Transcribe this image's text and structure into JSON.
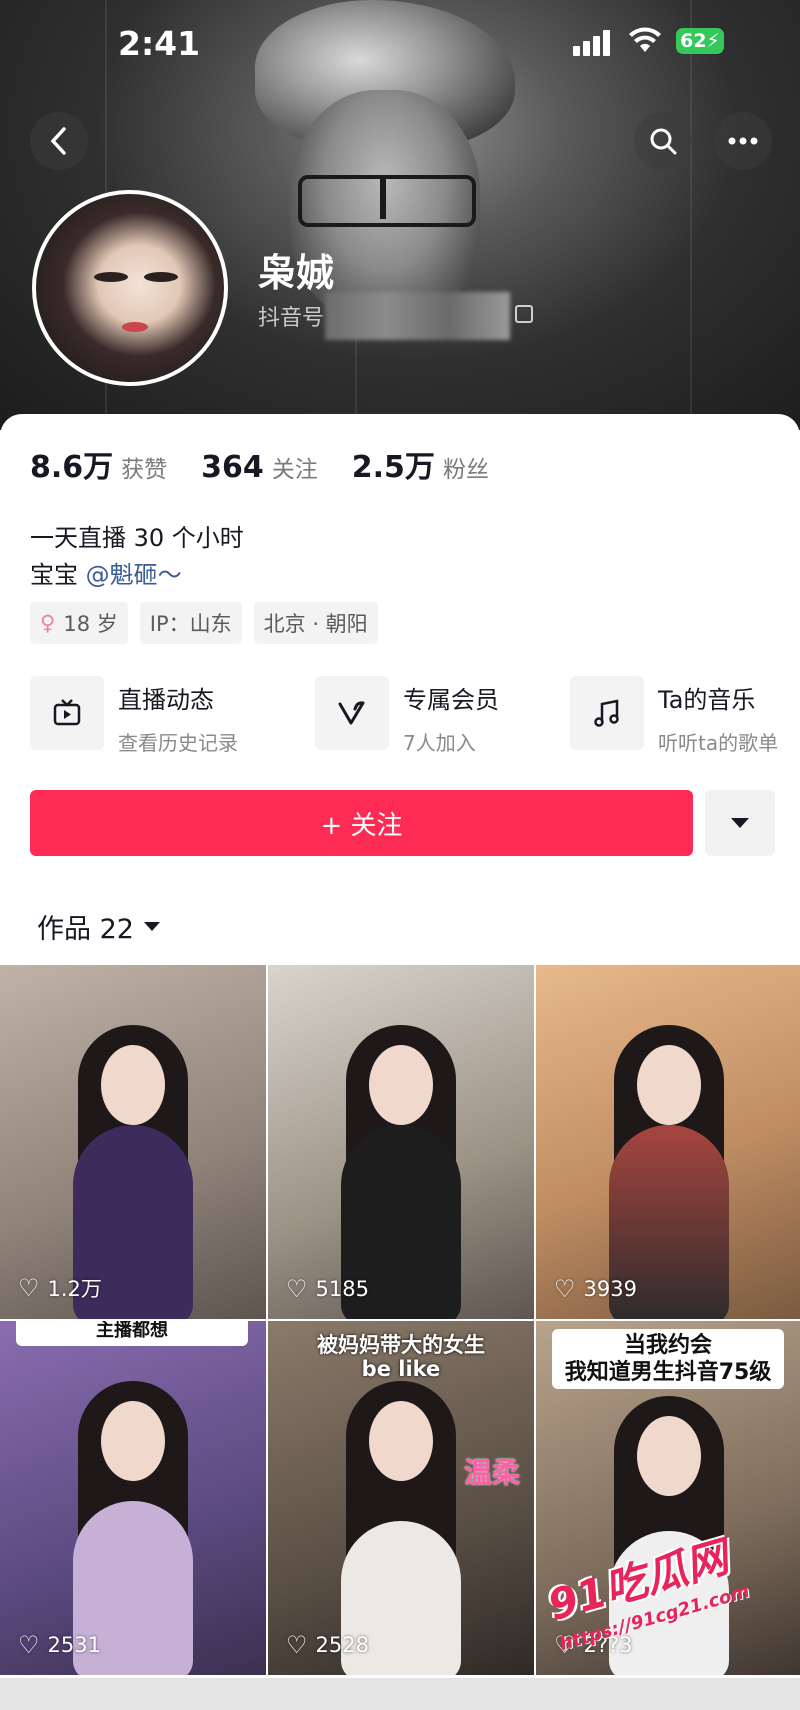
{
  "status_bar": {
    "time": "2:41",
    "battery": "62"
  },
  "profile": {
    "name": "枭娍",
    "douyin_id_label": "抖音号",
    "stats": [
      {
        "value": "8.6万",
        "label": "获赞"
      },
      {
        "value": "364",
        "label": "关注"
      },
      {
        "value": "2.5万",
        "label": "粉丝"
      }
    ],
    "bio_line1": "一天直播 30 个小时",
    "bio_line2_prefix": "宝宝",
    "bio_line2_mention": "@魁砸～",
    "tags": {
      "age": "18 岁",
      "ip": "IP：山东",
      "location": "北京 · 朝阳"
    }
  },
  "features": [
    {
      "title": "直播动态",
      "subtitle": "查看历史记录",
      "icon": "tv-icon"
    },
    {
      "title": "专属会员",
      "subtitle": "7人加入",
      "icon": "v-membership-icon"
    },
    {
      "title": "Ta的音乐",
      "subtitle": "听听ta的歌单",
      "icon": "music-note-icon"
    }
  ],
  "actions": {
    "follow_label": "+ 关注"
  },
  "works": {
    "tab_label": "作品 22",
    "items": [
      {
        "likes": "1.2万",
        "caption": ""
      },
      {
        "likes": "5185",
        "caption": ""
      },
      {
        "likes": "3939",
        "caption": ""
      },
      {
        "likes": "2531",
        "caption": "主播都想"
      },
      {
        "likes": "2528",
        "caption": "被妈妈带大的女生",
        "caption2": "be like",
        "overlay": "温柔"
      },
      {
        "likes": "2??3",
        "caption": "当我约会",
        "caption2": "我知道男生抖音75级"
      }
    ]
  },
  "watermark": {
    "brand": "91吃瓜网",
    "url": "https://91cg21.com"
  },
  "colors": {
    "accent": "#fe2c55",
    "mention": "#3a5b95",
    "battery": "#34c759"
  }
}
